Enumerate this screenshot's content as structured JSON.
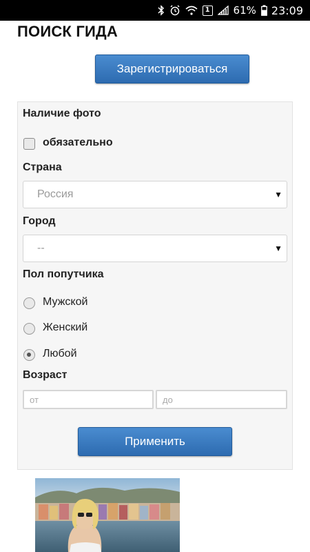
{
  "status_bar": {
    "battery": "61%",
    "time": "23:09",
    "notification_badge": "1",
    "icons": [
      "bluetooth-icon",
      "alarm-icon",
      "wifi-icon",
      "signal-icon",
      "battery-icon"
    ]
  },
  "page": {
    "title": "ПОИСК ГИДА",
    "register_label": "Зарегистрироваться",
    "apply_label": "Применить"
  },
  "filters": {
    "photo_label": "Наличие фото",
    "photo_required_label": "обязательно",
    "country_label": "Страна",
    "country_value": "Россия",
    "city_label": "Город",
    "city_value": "--",
    "gender_label": "Пол попутчика",
    "gender_options": [
      {
        "label": "Мужской",
        "checked": false
      },
      {
        "label": "Женский",
        "checked": false
      },
      {
        "label": "Любой",
        "checked": true
      }
    ],
    "age_label": "Возраст",
    "age_from_placeholder": "от",
    "age_to_placeholder": "до"
  },
  "colors": {
    "accent": "#2d6bb0",
    "panel_bg": "#f6f6f6"
  }
}
